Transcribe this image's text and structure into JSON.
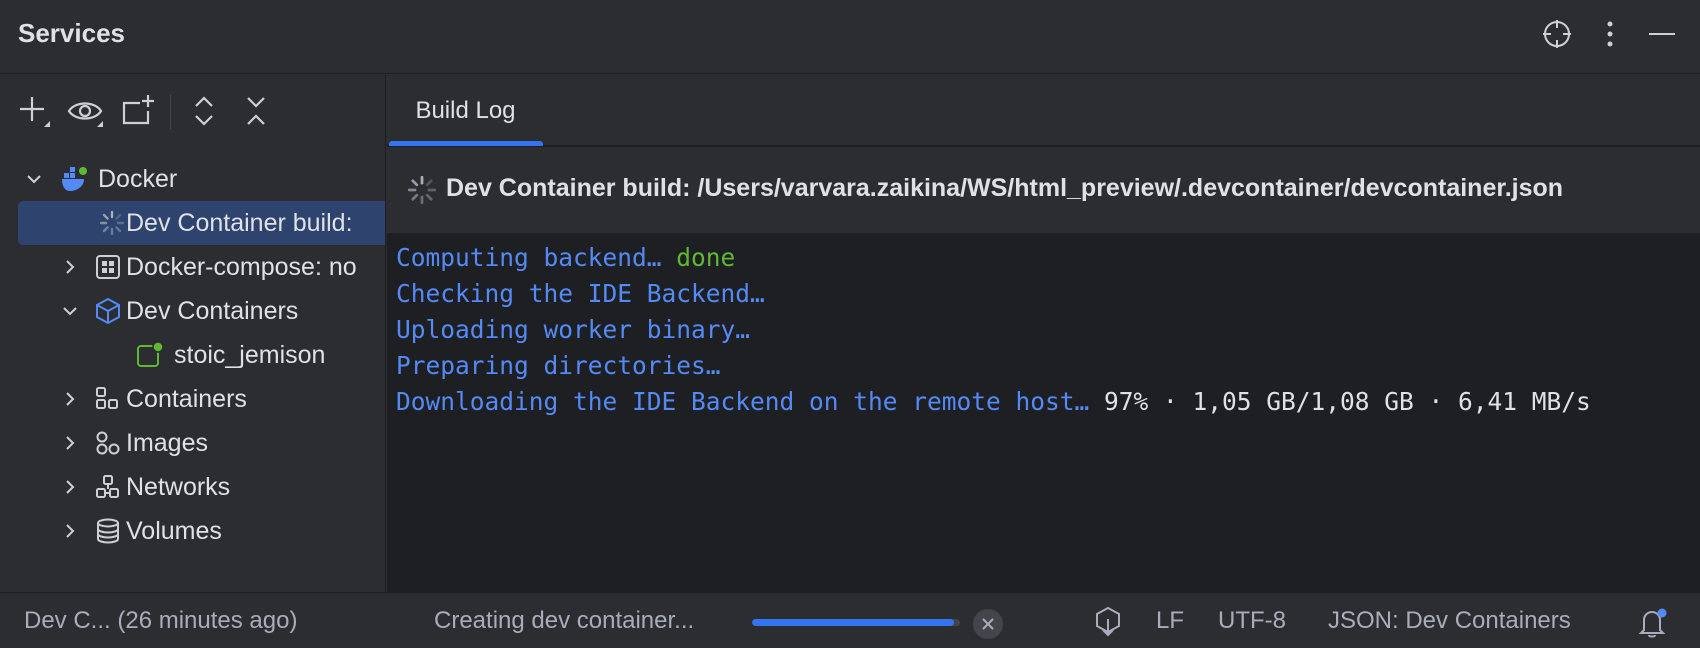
{
  "header": {
    "title": "Services"
  },
  "build_log_tab": {
    "label": "Build Log"
  },
  "build": {
    "title": "Dev Container build: /Users/varvara.zaikina/WS/html_preview/.devcontainer/devcontainer.json"
  },
  "tree": {
    "docker": "Docker",
    "dev_container_build": "Dev Container build:",
    "docker_compose": "Docker-compose: no",
    "dev_containers": "Dev Containers",
    "stoic": "stoic_jemison",
    "containers": "Containers",
    "images": "Images",
    "networks": "Networks",
    "volumes": "Volumes"
  },
  "log": {
    "line1_a": "Computing backend… ",
    "line1_b": "done",
    "line2": "Checking the IDE Backend…",
    "line3": "Uploading worker binary…",
    "line4": "Preparing directories…",
    "line5_a": "Downloading the IDE Backend on the remote host… ",
    "line5_b": "97% · 1,05 GB/1,08 GB · 6,41 MB/s"
  },
  "status": {
    "left": "Dev C... (26 minutes ago)",
    "task": "Creating dev container...",
    "progress": 0.97,
    "lf": "LF",
    "encoding": "UTF-8",
    "schema": "JSON: Dev Containers"
  },
  "colors": {
    "accent": "#3574f0",
    "log_blue": "#548af7",
    "done_green": "#5fb832",
    "selection": "#2e436e"
  }
}
